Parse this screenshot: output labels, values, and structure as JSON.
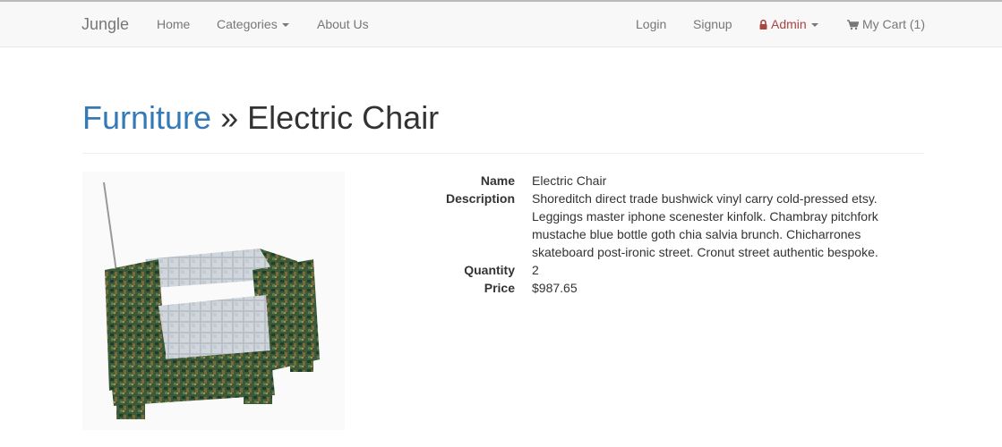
{
  "nav": {
    "brand": "Jungle",
    "home": "Home",
    "categories": "Categories",
    "about": "About Us",
    "login": "Login",
    "signup": "Signup",
    "admin": "Admin",
    "cart": "My Cart (1)"
  },
  "header": {
    "category": "Furniture",
    "separator": "»",
    "product_name": "Electric Chair"
  },
  "product": {
    "image_icon": "armchair-image",
    "fields": [
      {
        "label": "Name",
        "value": "Electric Chair"
      },
      {
        "label": "Description",
        "value": "Shoreditch direct trade bushwick vinyl carry cold-pressed etsy. Leggings master iphone scenester kinfolk. Chambray pitchfork mustache blue bottle goth chia salvia brunch. Chicharrones skateboard post-ironic street. Cronut street authentic bespoke."
      },
      {
        "label": "Quantity",
        "value": "2"
      },
      {
        "label": "Price",
        "value": "$987.65"
      }
    ]
  },
  "colors": {
    "link": "#337ab7",
    "admin": "#a94442",
    "navbar_bg": "#f8f8f8"
  }
}
